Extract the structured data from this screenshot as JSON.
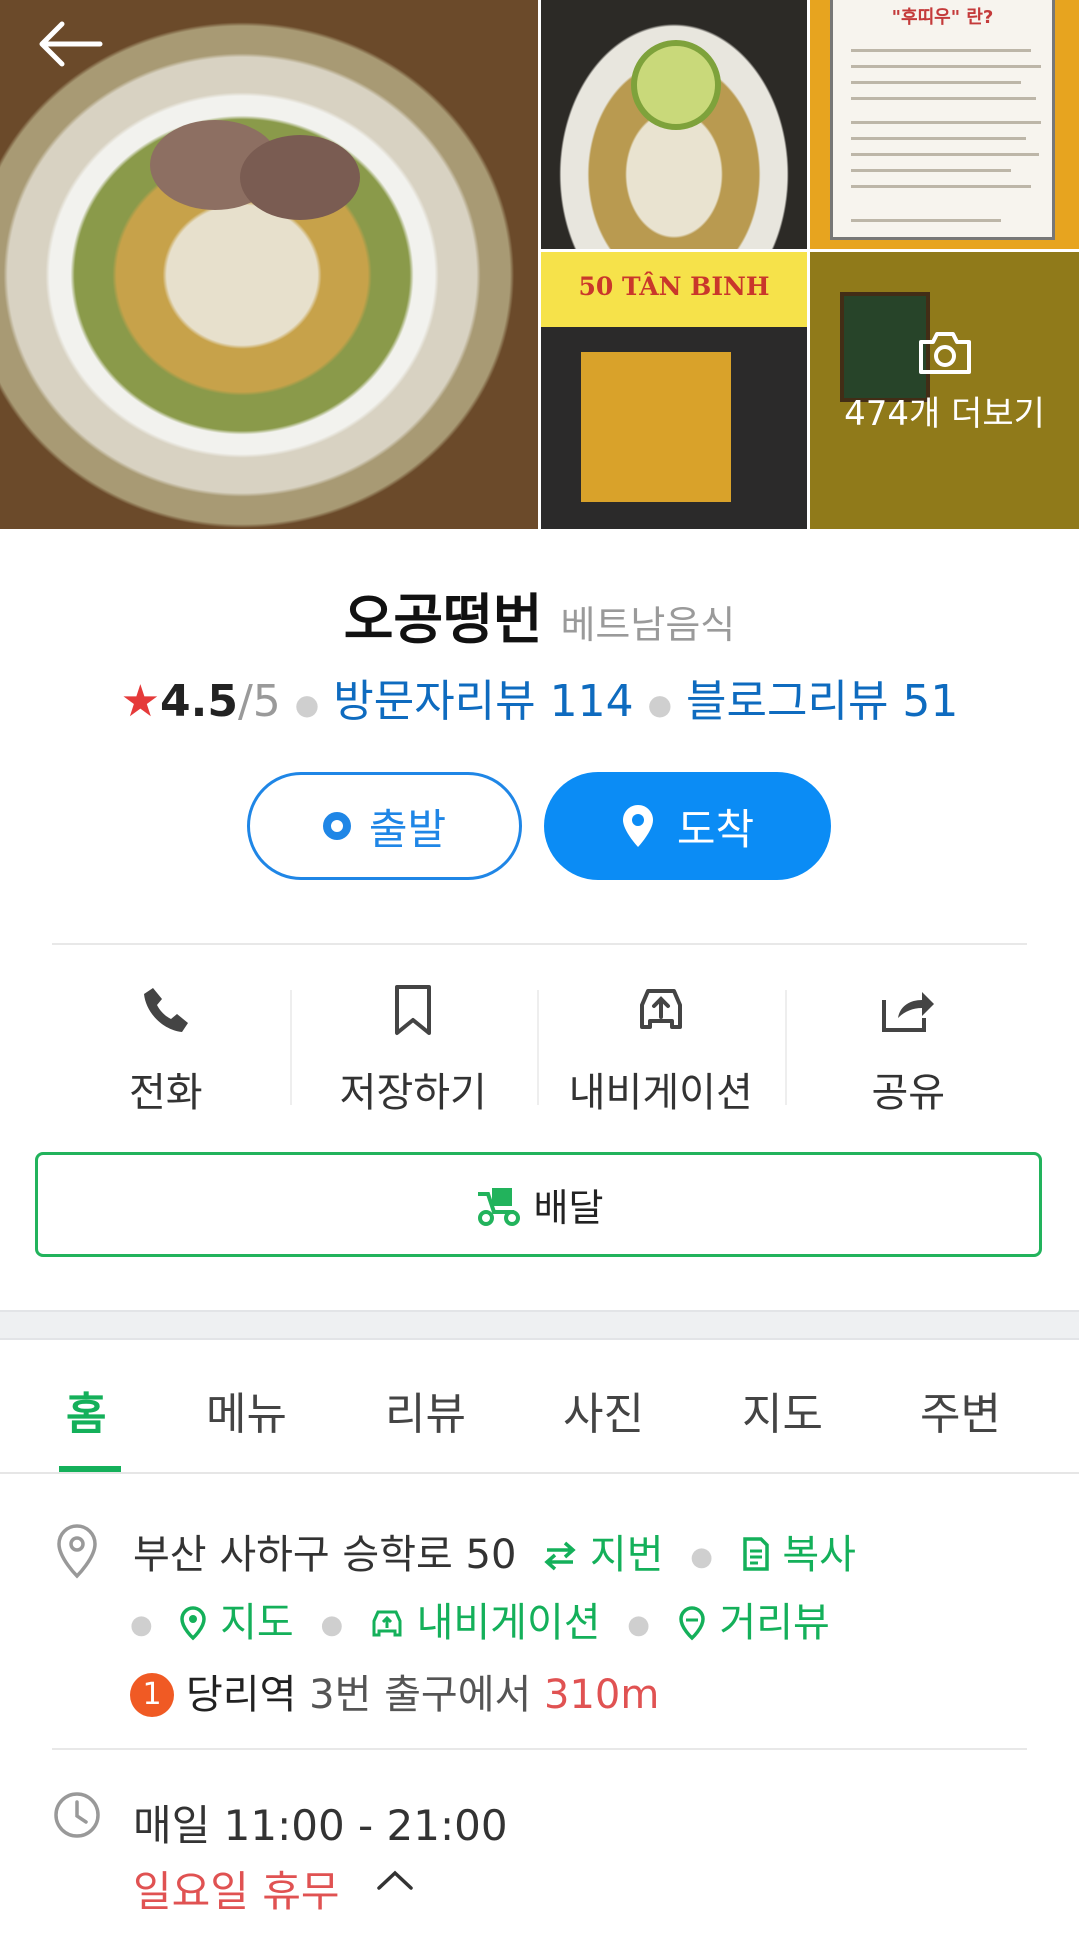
{
  "header": {
    "back_icon": "arrow-left-icon",
    "more_photos_label": "474개 더보기",
    "more_photos_icon": "camera-icon",
    "storefront_sign": "50 TÂN BINH",
    "notice_title": "\"후띠우\" 란?"
  },
  "place": {
    "name": "오공떵번",
    "category": "베트남음식",
    "rating": "4.5",
    "rating_max": "/5",
    "visitor_reviews": "방문자리뷰 114",
    "blog_reviews": "블로그리뷰 51"
  },
  "route": {
    "depart_label": "출발",
    "arrive_label": "도착"
  },
  "actions": [
    {
      "label": "전화",
      "icon": "phone-icon"
    },
    {
      "label": "저장하기",
      "icon": "bookmark-icon"
    },
    {
      "label": "내비게이션",
      "icon": "car-navigation-icon"
    },
    {
      "label": "공유",
      "icon": "share-icon"
    }
  ],
  "delivery": {
    "label": "배달",
    "icon": "delivery-scooter-icon"
  },
  "tabs": [
    {
      "label": "홈",
      "active": true
    },
    {
      "label": "메뉴"
    },
    {
      "label": "리뷰"
    },
    {
      "label": "사진"
    },
    {
      "label": "지도"
    },
    {
      "label": "주변"
    }
  ],
  "info": {
    "address": "부산 사하구 승학로 50",
    "jibun_label": "지번",
    "copy_label": "복사",
    "map_label": "지도",
    "navigation_label": "내비게이션",
    "streetview_label": "거리뷰",
    "subway_line": "1",
    "subway_station": "당리역",
    "subway_exit": "3번 출구에서",
    "subway_distance": "310m",
    "hours": "매일 11:00 - 21:00",
    "closed_day": "일요일 휴무"
  },
  "colors": {
    "primary_blue": "#0b8cf5",
    "link_blue": "#0e6bbf",
    "naver_green": "#14b05a",
    "alert_red": "#e05252",
    "star_red": "#e53a3a",
    "subway_line1_orange": "#f05a24"
  }
}
